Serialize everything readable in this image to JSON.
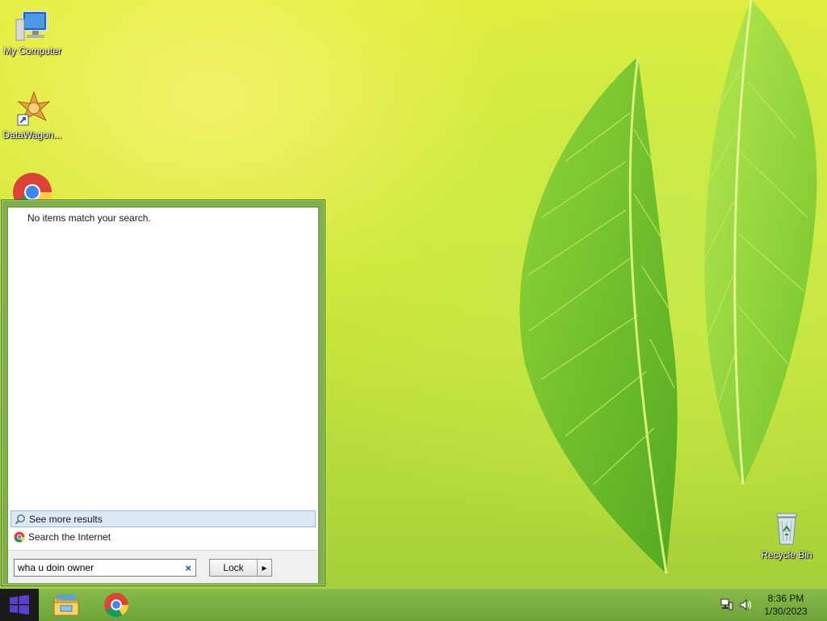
{
  "desktop": {
    "icons": [
      {
        "label": "My Computer",
        "icon": "computer-icon"
      },
      {
        "label": "DataWagon...",
        "icon": "datawagon-icon"
      },
      {
        "label": "",
        "icon": "chrome-icon"
      },
      {
        "label": "Recycle Bin",
        "icon": "recycle-bin-icon"
      }
    ]
  },
  "start_menu": {
    "no_results_text": "No items match your search.",
    "see_more_label": "See more results",
    "search_internet_label": "Search the Internet",
    "search_value": "wha u doin owner",
    "clear_symbol": "×",
    "power_button_label": "Lock",
    "power_arrow": "▶"
  },
  "taskbar": {
    "pinned": [
      {
        "name": "file-explorer",
        "icon": "folder-icon"
      },
      {
        "name": "chrome",
        "icon": "chrome-icon"
      }
    ],
    "tray_icons": [
      "network-icon",
      "volume-icon"
    ],
    "clock_time": "8:36 PM",
    "clock_date": "1/30/2023"
  },
  "colors": {
    "taskbar": "#78ab40",
    "start_menu_frame": "#7fb04a",
    "see_more_highlight": "#dce8f5"
  }
}
